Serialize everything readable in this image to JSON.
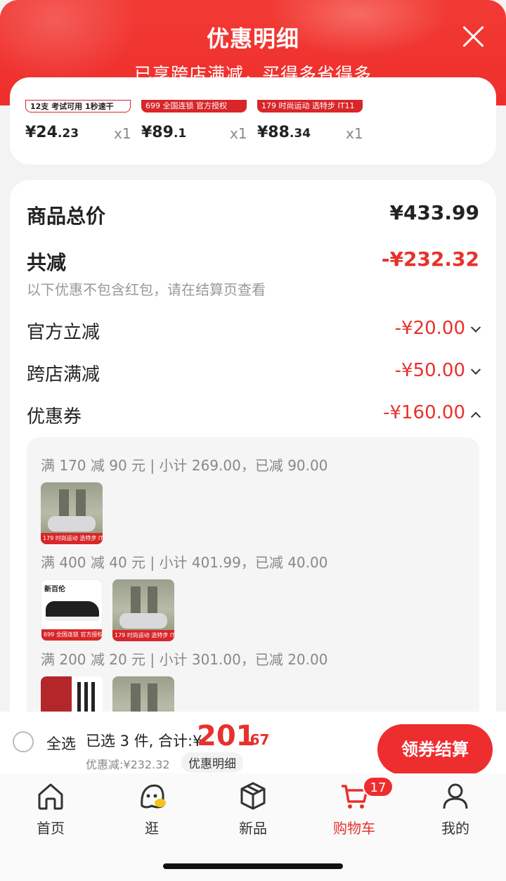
{
  "header": {
    "title": "优惠明细",
    "subtitle": "已享跨店满减，买得多省得多"
  },
  "products": [
    {
      "banner": "12支  考试可用 1秒速干",
      "price_main": "¥24",
      "price_frac": ".23",
      "qty": "x1",
      "banner_color": "#ffffff"
    },
    {
      "banner": "699  全国连锁 官方授权",
      "price_main": "¥89",
      "price_frac": ".1",
      "qty": "x1",
      "banner_color": "#d8262a"
    },
    {
      "banner": "179  时尚运动 选特步 IT11",
      "price_main": "¥88",
      "price_frac": ".34",
      "qty": "x1",
      "banner_color": "#d8262a"
    }
  ],
  "summary": {
    "total_label": "商品总价",
    "total_value": "¥433.99",
    "reduce_label": "共减",
    "reduce_value": "-¥232.32",
    "note": "以下优惠不包含红包，请在结算页查看",
    "lines": [
      {
        "label": "官方立减",
        "value": "-¥20.00",
        "chevron": "down"
      },
      {
        "label": "跨店满减",
        "value": "-¥50.00",
        "chevron": "down"
      },
      {
        "label": "优惠券",
        "value": "-¥160.00",
        "chevron": "up"
      }
    ]
  },
  "coupons": [
    {
      "label": "满 170 减 90 元 | 小计 269.00，已减 90.00"
    },
    {
      "label": "满 400 减 40 元 | 小计 401.99，已减 40.00"
    },
    {
      "label": "满 200 减 20 元 | 小计 301.00，已减 20.00"
    }
  ],
  "thumb_tags": {
    "sneaker": "179  时尚运动 选特步 IT11",
    "nb": "699  全国连锁 官方授权",
    "nb_title": "新百伦",
    "pen": ""
  },
  "checkout": {
    "select_all": "全选",
    "selected": "已选 3 件, 合计:¥",
    "total_main": "201",
    "total_frac": ".67",
    "discount": "优惠减:¥232.32",
    "detail_chip": "优惠明细",
    "button": "领券结算"
  },
  "tabs": [
    {
      "label": "首页",
      "icon": "home-icon"
    },
    {
      "label": "逛",
      "icon": "mascot-icon"
    },
    {
      "label": "新品",
      "icon": "box-icon"
    },
    {
      "label": "购物车",
      "icon": "cart-icon",
      "badge": "17",
      "active": true
    },
    {
      "label": "我的",
      "icon": "user-icon"
    }
  ],
  "colors": {
    "accent": "#e8312c",
    "header": "#f23a34"
  }
}
